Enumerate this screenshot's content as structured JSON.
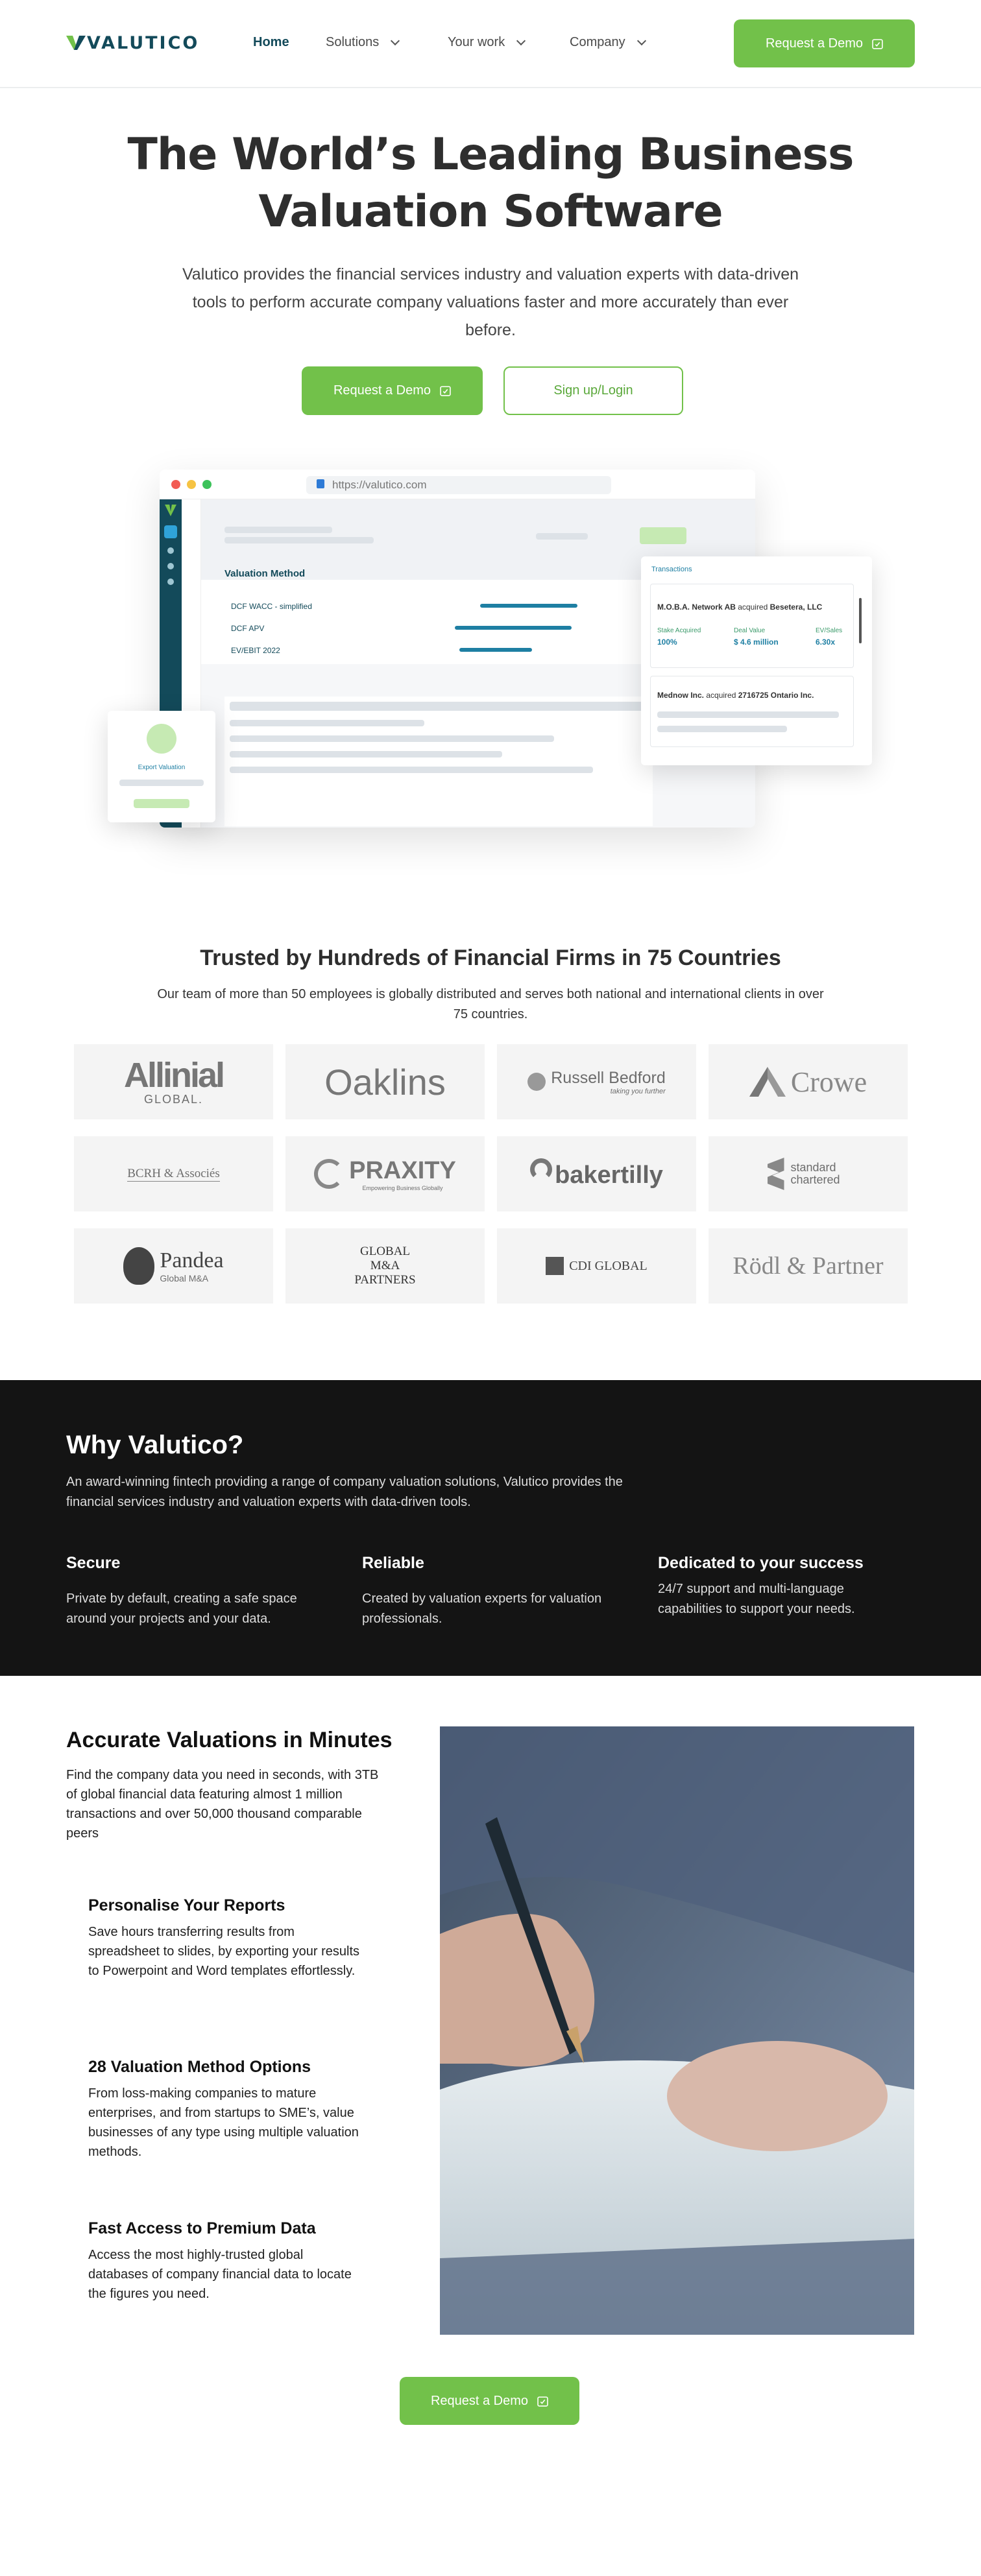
{
  "header": {
    "logo": "VALUTICO",
    "nav": [
      {
        "label": "Home"
      },
      {
        "label": "Solutions"
      },
      {
        "label": "Your work"
      },
      {
        "label": "Company"
      }
    ],
    "cta": "Request a Demo"
  },
  "hero": {
    "title_line1": "The World’s Leading Business",
    "title_line2": "Valuation Software",
    "lead": "Valutico provides the financial services industry and valuation experts with data-driven tools to perform accurate company valuations faster and more accurately than ever before.",
    "primary_cta": "Request a Demo",
    "secondary_cta": "Sign up/Login"
  },
  "mockup": {
    "url": "https://valutico.com",
    "valuation_method": "Valuation Method",
    "methods": [
      "DCF WACC - simplified",
      "DCF APV",
      "EV/EBIT 2022"
    ],
    "transactions_title": "Transactions",
    "deal1": {
      "acquirer": "M.O.B.A. Network AB",
      "verb": "acquired",
      "target": "Besetera, LLC"
    },
    "deal1_stats": [
      {
        "label": "Stake Acquired",
        "value": "100%"
      },
      {
        "label": "Deal Value",
        "value": "$ 4.6 million"
      },
      {
        "label": "EV/Sales",
        "value": "6.30x"
      }
    ],
    "deal2": {
      "acquirer": "Mednow Inc.",
      "verb": "acquired",
      "target": "2716725 Ontario Inc."
    },
    "export_label": "Export Valuation"
  },
  "trusted": {
    "title": "Trusted by Hundreds of Financial Firms in 75 Countries",
    "subtitle": "Our team of more than 50 employees is globally distributed and serves both national and international clients in over 75 countries.",
    "logos": [
      {
        "name": "Allinial",
        "tagline": "GLOBAL."
      },
      {
        "name": "Oaklins"
      },
      {
        "name": "Russell Bedford",
        "tagline": "taking you further"
      },
      {
        "name": "Crowe"
      },
      {
        "name": "BCRH & Associés"
      },
      {
        "name": "PRAXITY",
        "tagline": "Empowering Business Globally"
      },
      {
        "name": "bakertilly"
      },
      {
        "name": "standard chartered"
      },
      {
        "name": "Pandea",
        "tagline": "Global M&A"
      },
      {
        "name": "GLOBAL M&A PARTNERS"
      },
      {
        "name": "CDI GLOBAL"
      },
      {
        "name": "Rödl & Partner"
      }
    ]
  },
  "why": {
    "title": "Why Valutico?",
    "text": "An award-winning fintech providing a range of company valuation solutions, Valutico provides the financial services industry and valuation experts with data-driven tools.",
    "features": [
      {
        "title": "Secure",
        "desc": "Private by default, creating a safe space around your projects and your data."
      },
      {
        "title": "Reliable",
        "desc": "Created by valuation experts for valuation professionals."
      },
      {
        "title": "Dedicated to your success",
        "desc": "24/7 support and multi-language capabilities to support your  needs."
      }
    ]
  },
  "accurate": {
    "title": "Accurate Valuations in Minutes",
    "text": "Find the company data you need in seconds, with 3TB of global financial data featuring almost 1 million transactions and over 50,000 thousand comparable peers",
    "items": [
      {
        "title": "Personalise Your Reports",
        "desc": "Save hours transferring results from spreadsheet to slides, by exporting your results to Powerpoint and Word templates effortlessly."
      },
      {
        "title": "28 Valuation Method Options",
        "desc": "From loss-making companies to mature enterprises, and from startups to SME’s, value businesses of any type using multiple valuation methods."
      },
      {
        "title": "Fast Access to Premium Data",
        "desc": "Access the most highly-trusted global databases of company financial data to locate the figures you need."
      }
    ],
    "cta": "Request a Demo"
  },
  "colors": {
    "brand": "#134a5a",
    "accent": "#72c14a",
    "dark": "#141414"
  },
  "icons": [
    "calendar-check-icon",
    "chevron-down-icon",
    "lock-icon",
    "export-icon",
    "pen-photo"
  ]
}
